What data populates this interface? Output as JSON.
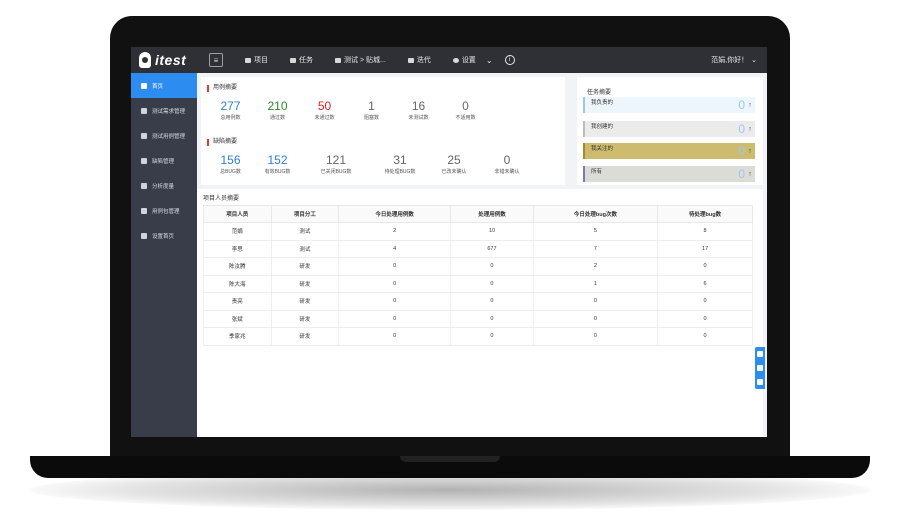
{
  "app": {
    "logo_text": "itest",
    "user_greeting": "范娟,你好！",
    "user_caret": "⌄"
  },
  "topnav": [
    {
      "label": "项目",
      "icon": "folder-icon"
    },
    {
      "label": "任务",
      "icon": "briefcase-icon"
    },
    {
      "label": "测试 > 贴城...",
      "icon": "chat-icon"
    },
    {
      "label": "迭代",
      "icon": "copy-icon"
    },
    {
      "label": "设置",
      "icon": "gear-icon"
    }
  ],
  "sidebar": [
    {
      "label": "首页",
      "icon": "home-icon"
    },
    {
      "label": "测试需求管理",
      "icon": "briefcase-icon"
    },
    {
      "label": "测试用例管理",
      "icon": "document-icon"
    },
    {
      "label": "缺陷管理",
      "icon": "tools-icon"
    },
    {
      "label": "分析度量",
      "icon": "bar-chart-icon"
    },
    {
      "label": "用例包管理",
      "icon": "package-icon"
    },
    {
      "label": "设置首页",
      "icon": "home-icon"
    }
  ],
  "case_summary": {
    "title": "用例摘要",
    "stats": [
      {
        "value": "277",
        "label": "总用例数",
        "color": "#2d7fd3"
      },
      {
        "value": "210",
        "label": "通过数",
        "color": "#2a8a2a"
      },
      {
        "value": "50",
        "label": "未通过数",
        "color": "#e02020"
      },
      {
        "value": "1",
        "label": "阻塞数",
        "color": "#666666"
      },
      {
        "value": "16",
        "label": "未测试数",
        "color": "#666666"
      },
      {
        "value": "0",
        "label": "不适用数",
        "color": "#666666"
      }
    ]
  },
  "bug_summary": {
    "title": "缺陷摘要",
    "stats": [
      {
        "value": "156",
        "label": "总BUG数",
        "color": "#2d7fd3"
      },
      {
        "value": "152",
        "label": "有效BUG数",
        "color": "#2d7fd3"
      },
      {
        "value": "121",
        "label": "已关闭BUG数",
        "color": "#666666"
      },
      {
        "value": "31",
        "label": "待处理BUG数",
        "color": "#666666"
      },
      {
        "value": "25",
        "label": "已改未确认",
        "color": "#666666"
      },
      {
        "value": "0",
        "label": "非错未确认",
        "color": "#666666"
      }
    ]
  },
  "task_summary": {
    "title": "任务摘要",
    "items": [
      {
        "label": "我负责的",
        "value": "0",
        "arrow": "↑",
        "bg": "#eef6fd",
        "border": "#9fc6ee"
      },
      {
        "label": "我创建的",
        "value": "0",
        "arrow": "↑",
        "bg": "#ebebeb",
        "border": "#bdbdbd"
      },
      {
        "label": "我关注的",
        "value": "0",
        "arrow": "↑",
        "bg": "#cdbb6e",
        "border": "#a08a30"
      },
      {
        "label": "所有",
        "value": "0",
        "arrow": "↑",
        "bg": "#dcdcd6",
        "border": "#7a77c8"
      }
    ]
  },
  "team": {
    "title": "项目人员摘要",
    "columns": [
      "项目人员",
      "项目分工",
      "今日处理用例数",
      "处理用例数",
      "今日处理bug次数",
      "待处理bug数"
    ],
    "rows": [
      [
        "范娟",
        "测试",
        "2",
        "10",
        "5",
        "8"
      ],
      [
        "李思",
        "测试",
        "4",
        "677",
        "7",
        "17"
      ],
      [
        "陈汝腾",
        "研发",
        "0",
        "0",
        "2",
        "0"
      ],
      [
        "陈大海",
        "研发",
        "0",
        "0",
        "1",
        "6"
      ],
      [
        "责亮",
        "研发",
        "0",
        "0",
        "0",
        "0"
      ],
      [
        "张斌",
        "研发",
        "0",
        "0",
        "0",
        "0"
      ],
      [
        "季家兆",
        "研发",
        "0",
        "0",
        "0",
        "0"
      ]
    ]
  }
}
